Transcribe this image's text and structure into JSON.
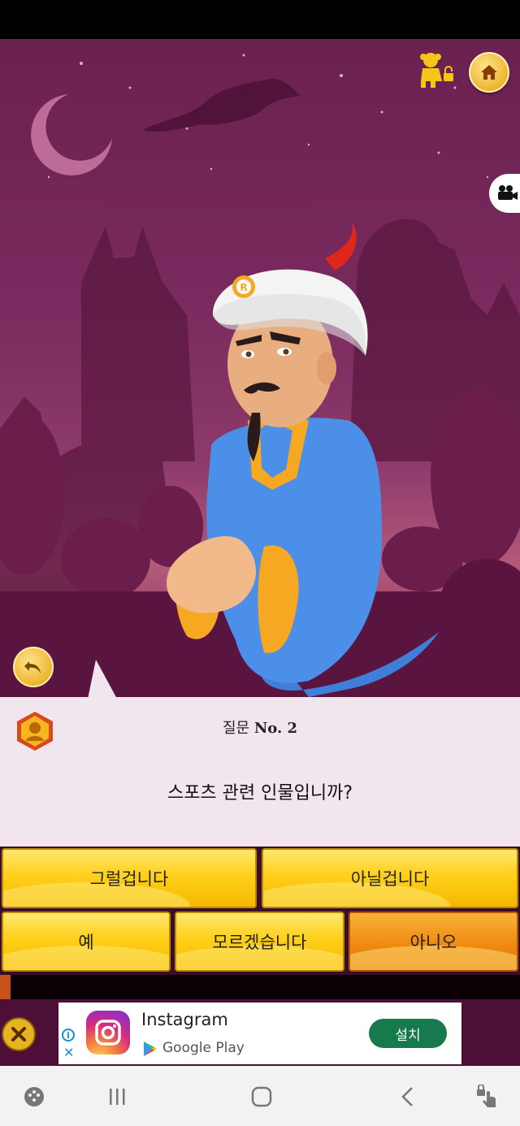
{
  "question": {
    "prefix": "질문",
    "number_label": "No. 2",
    "text": "스포츠 관련 인물입니까?"
  },
  "answers": [
    {
      "label": "그럴겁니다"
    },
    {
      "label": "아닐겁니다"
    },
    {
      "label": "예"
    },
    {
      "label": "모르겠습니다"
    },
    {
      "label": "아니오"
    }
  ],
  "progress": {
    "fraction": 0.02
  },
  "ad": {
    "app_name": "Instagram",
    "store": "Google Play",
    "install_label": "설치"
  },
  "icons": {
    "home": "home-icon",
    "kid_mode": "child-lock-icon",
    "video": "video-camera-icon",
    "undo": "undo-icon",
    "badge": "player-badge-icon"
  },
  "colors": {
    "answer_yellow": "#ffd01a",
    "answer_orange": "#f08a10",
    "panel": "#f1e6ee",
    "sky": "#6a2150",
    "install_green": "#167a4c"
  }
}
